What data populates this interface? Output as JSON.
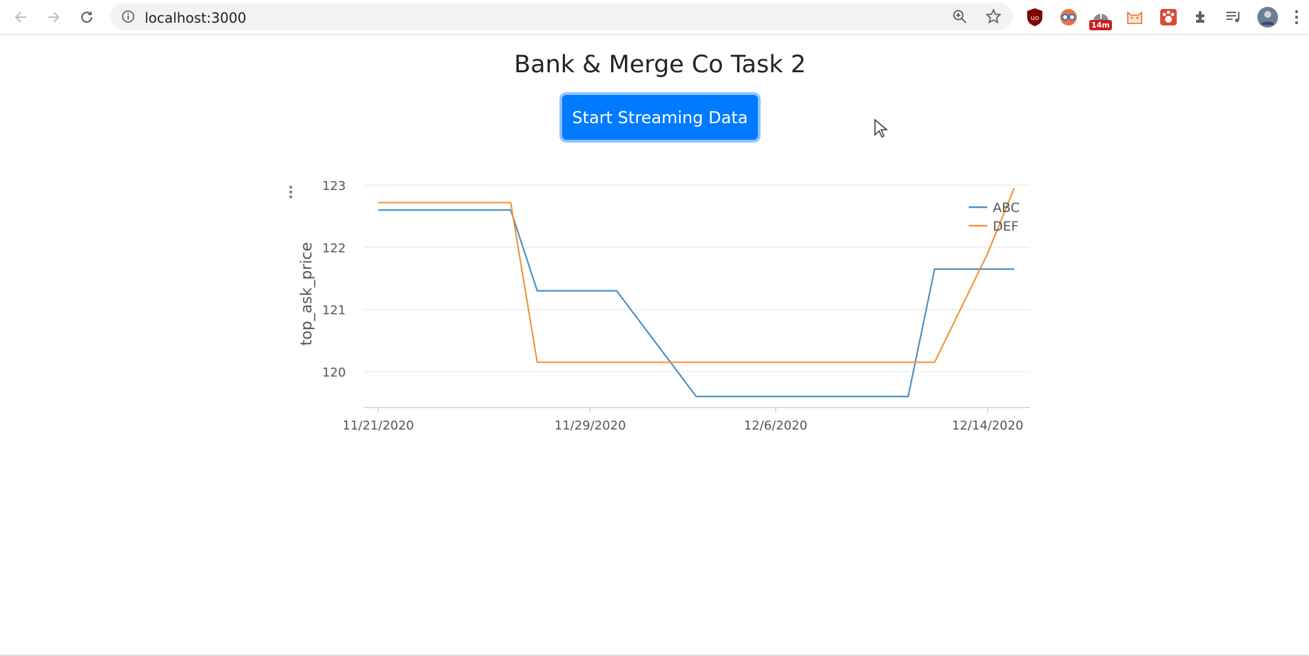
{
  "browser": {
    "url": "localhost:3000",
    "extensions": [
      "ublock-icon",
      "reader-icon",
      "timer-icon",
      "cat-icon",
      "paw-icon",
      "puzzle-icon",
      "playlist-icon"
    ],
    "timer_badge": "14m"
  },
  "page": {
    "title": "Bank & Merge Co Task 2",
    "stream_button": "Start Streaming Data"
  },
  "chart_data": {
    "type": "line",
    "ylabel": "top_ask_price",
    "xlabel": "",
    "x_ticks": [
      "11/21/2020",
      "11/29/2020",
      "12/6/2020",
      "12/14/2020"
    ],
    "y_ticks": [
      "120",
      "121",
      "122",
      "123"
    ],
    "ylim": [
      119.6,
      123
    ],
    "legend_position": "top-right",
    "series": [
      {
        "name": "ABC",
        "color": "#4a90c4",
        "points": [
          {
            "x": "2020-11-21",
            "y": 122.6
          },
          {
            "x": "2020-11-26",
            "y": 122.6
          },
          {
            "x": "2020-11-27",
            "y": 121.3
          },
          {
            "x": "2020-11-30",
            "y": 121.3
          },
          {
            "x": "2020-12-03",
            "y": 119.6
          },
          {
            "x": "2020-12-11",
            "y": 119.6
          },
          {
            "x": "2020-12-12",
            "y": 121.65
          },
          {
            "x": "2020-12-15",
            "y": 121.65
          }
        ]
      },
      {
        "name": "DEF",
        "color": "#f2953a",
        "points": [
          {
            "x": "2020-11-21",
            "y": 122.72
          },
          {
            "x": "2020-11-26",
            "y": 122.72
          },
          {
            "x": "2020-11-27",
            "y": 120.15
          },
          {
            "x": "2020-12-12",
            "y": 120.15
          },
          {
            "x": "2020-12-14",
            "y": 121.9
          },
          {
            "x": "2020-12-15",
            "y": 122.95
          }
        ]
      }
    ]
  }
}
